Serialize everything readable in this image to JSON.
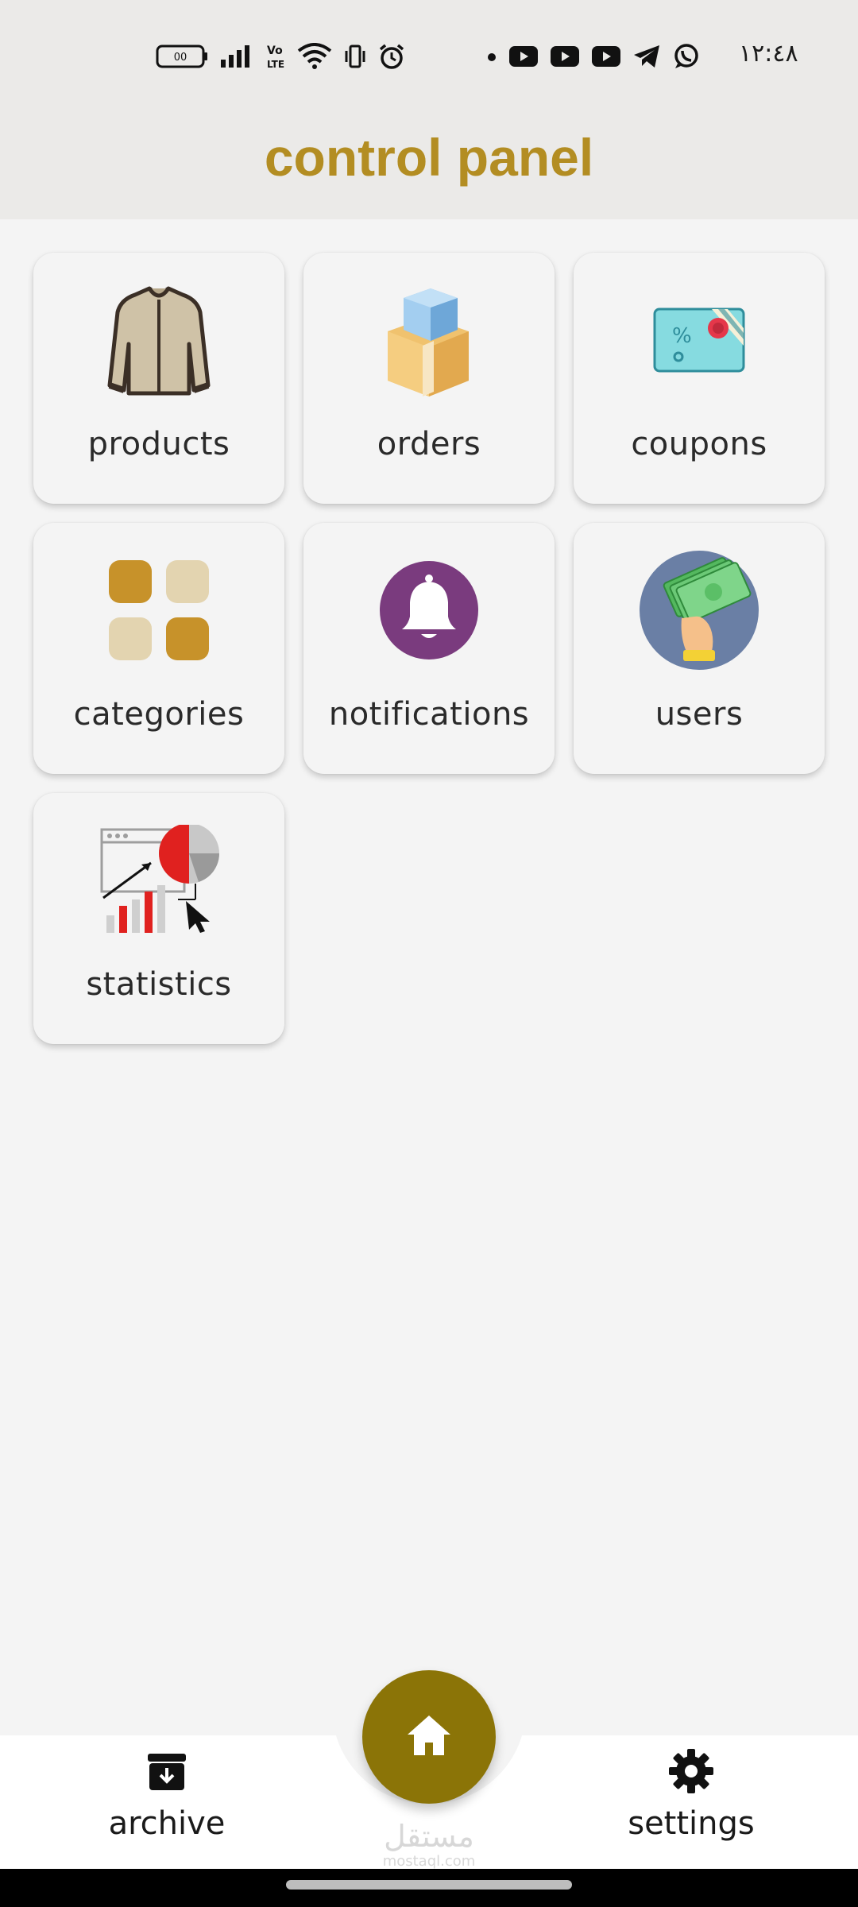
{
  "status_bar": {
    "time": "١٢:٤٨",
    "battery_text": "00",
    "icons_left": [
      "battery-icon",
      "signal-icon",
      "volte-icon",
      "wifi-icon",
      "vibrate-icon",
      "alarm-icon"
    ],
    "icons_right": [
      "dot-icon",
      "youtube-icon",
      "youtube-icon",
      "youtube-icon",
      "telegram-icon",
      "whatsapp-icon"
    ]
  },
  "header": {
    "title": "control panel"
  },
  "tiles": [
    {
      "label": "products",
      "icon": "shirt-icon"
    },
    {
      "label": "orders",
      "icon": "boxes-icon"
    },
    {
      "label": "coupons",
      "icon": "coupon-icon"
    },
    {
      "label": "categories",
      "icon": "categories-grid-icon"
    },
    {
      "label": "notifications",
      "icon": "bell-icon"
    },
    {
      "label": "users",
      "icon": "money-hand-icon"
    },
    {
      "label": "statistics",
      "icon": "statistics-chart-icon"
    }
  ],
  "bottom_nav": {
    "archive_label": "archive",
    "settings_label": "settings",
    "home_icon": "home-icon"
  },
  "watermark": {
    "text_ar": "مستقل",
    "text_en": "mostaql.com"
  },
  "colors": {
    "title": "#b38d22",
    "fab": "#8b7407",
    "header_bg": "#ebeae8",
    "page_bg": "#f4f4f4",
    "category_gold": "#c7922a",
    "category_beige": "#e3d4b0",
    "bell_purple": "#7a3b7e",
    "users_blue": "#6a7fa5"
  }
}
